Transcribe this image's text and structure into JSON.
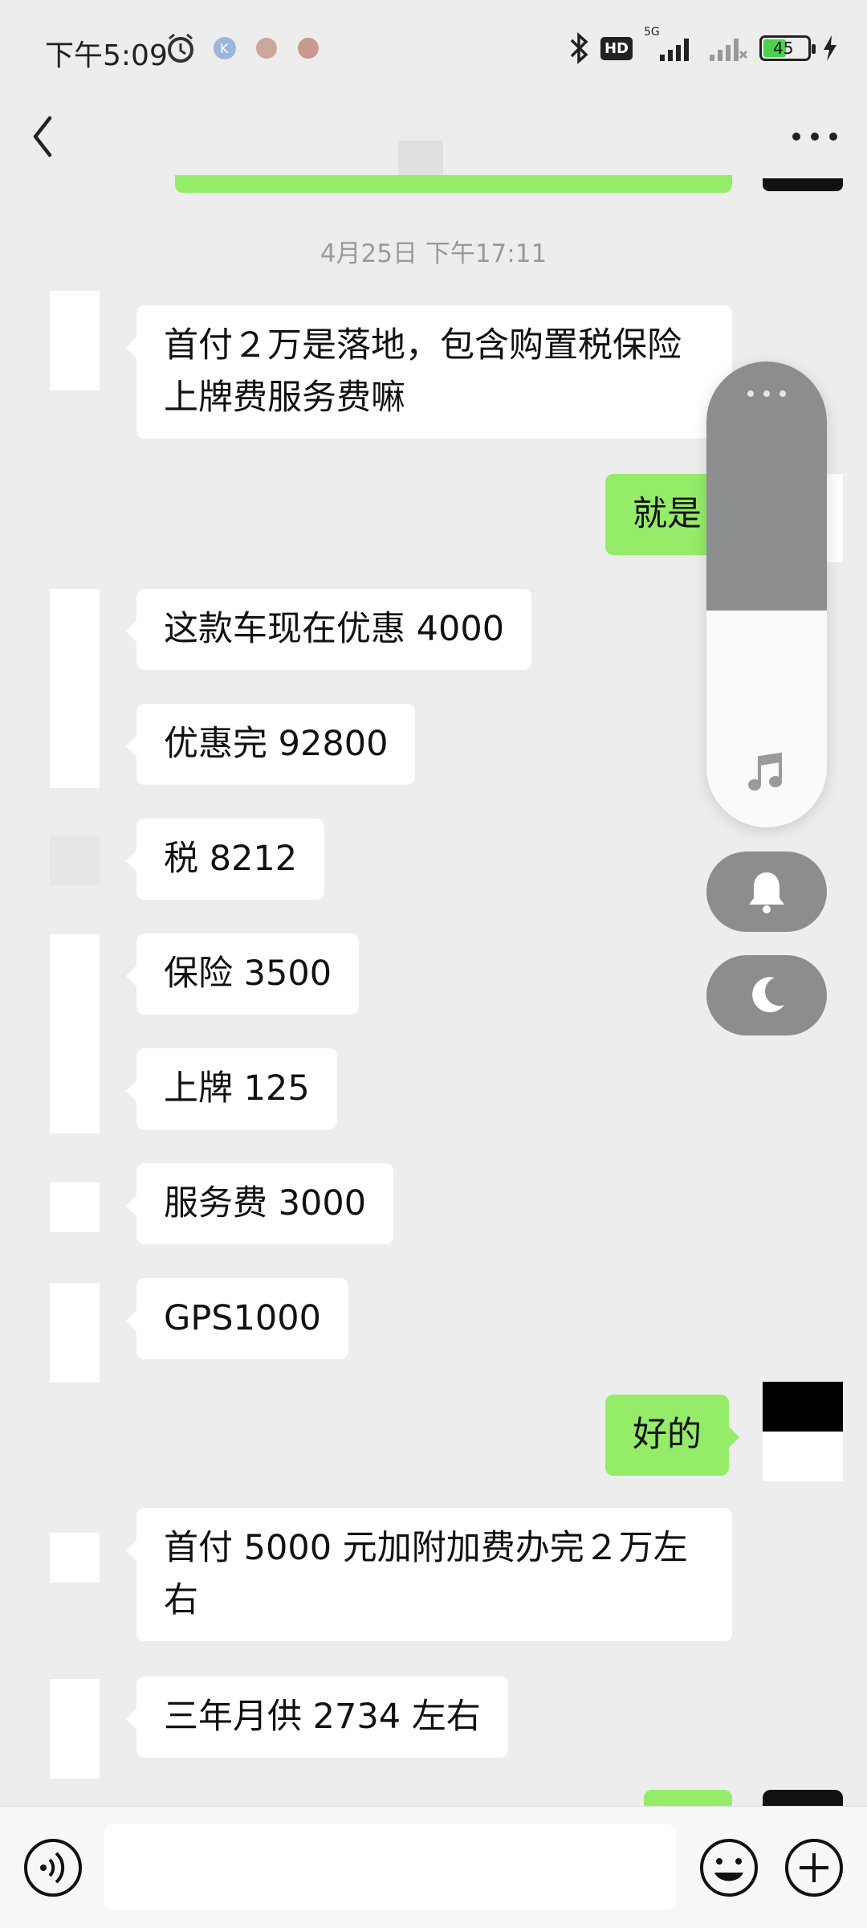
{
  "status_bar": {
    "time": "下午5:09",
    "network": "5G",
    "hd": "HD",
    "battery": "45"
  },
  "chat": {
    "timestamp": "4月25日 下午17:11",
    "messages": [
      {
        "side": "in",
        "text": "首付２万是落地，包含购置税保险上牌费服务费嘛"
      },
      {
        "side": "out",
        "text": "就是"
      },
      {
        "side": "in",
        "text": "这款车现在优惠 4000"
      },
      {
        "side": "in",
        "text": "优惠完 92800"
      },
      {
        "side": "in",
        "text": "税 8212"
      },
      {
        "side": "in",
        "text": "保险 3500"
      },
      {
        "side": "in",
        "text": "上牌 125"
      },
      {
        "side": "in",
        "text": "服务费 3000"
      },
      {
        "side": "in",
        "text": "GPS1000"
      },
      {
        "side": "out",
        "text": "好的"
      },
      {
        "side": "in",
        "text": "首付 5000 元加附加费办完２万左右"
      },
      {
        "side": "in",
        "text": "三年月供 2734 左右"
      }
    ]
  },
  "colors": {
    "background": "#ededed",
    "bubble_out": "#95ec69",
    "bubble_in": "#ffffff",
    "float_panel": "#8c8d8e"
  },
  "icons": {
    "back": "chevron-left-icon",
    "more": "more-dots-icon",
    "voice": "voice-icon",
    "emoji": "emoji-icon",
    "add": "plus-circle-icon",
    "music": "music-note-icon",
    "bell": "bell-icon",
    "moon": "moon-icon"
  }
}
